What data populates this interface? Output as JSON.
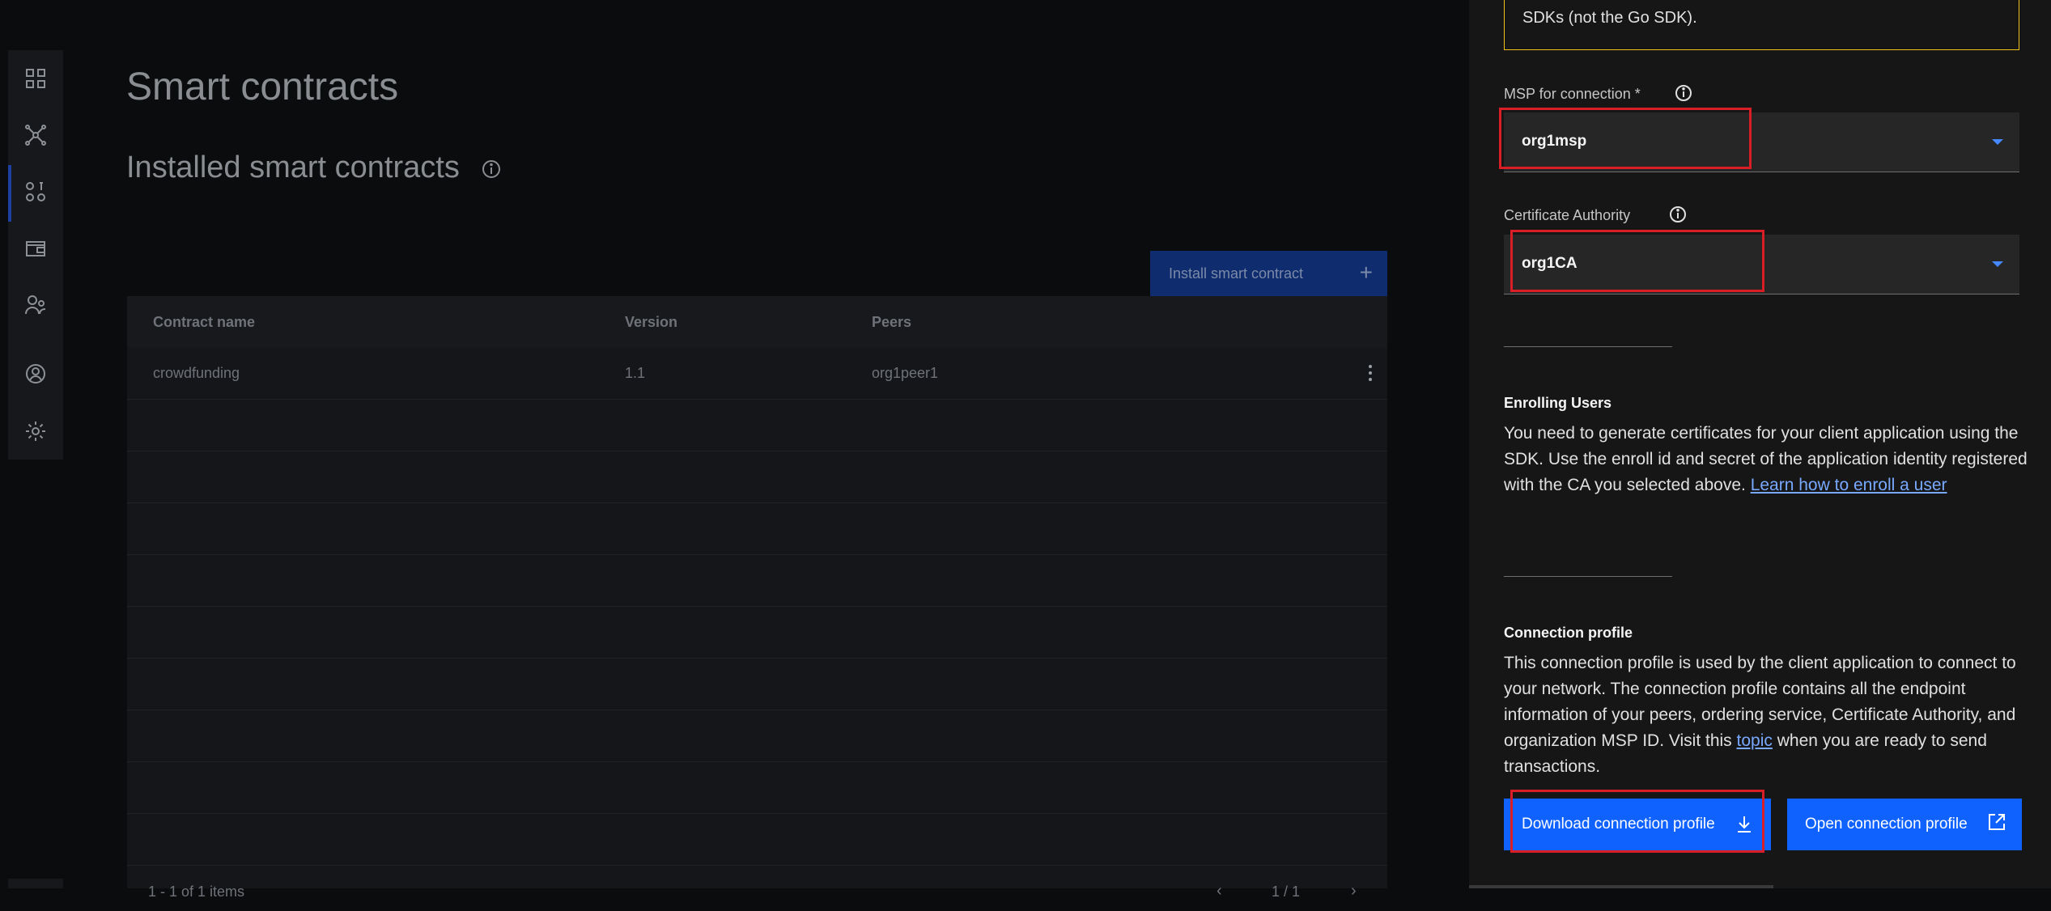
{
  "main": {
    "page_title": "Smart contracts",
    "section_title": "Installed smart contracts",
    "install_button": "Install smart contract",
    "table": {
      "headers": [
        "Contract name",
        "Version",
        "Peers"
      ],
      "rows": [
        {
          "name": "crowdfunding",
          "version": "1.1",
          "peers": "org1peer1"
        }
      ],
      "footer_items": "1 - 1 of 1 items",
      "footer_pages": "1 / 1"
    }
  },
  "panel": {
    "warning_text": "SDKs (not the Go SDK).",
    "msp_label": "MSP for connection *",
    "msp_value": "org1msp",
    "ca_label": "Certificate Authority",
    "ca_value": "org1CA",
    "enrolling_heading": "Enrolling Users",
    "enrolling_text": "You need to generate certificates for your client application using the SDK. Use the enroll id and secret of the application identity registered with the CA you selected above.",
    "enrolling_link": "Learn how to enroll a user",
    "profile_heading": "Connection profile",
    "profile_text_1": "This connection profile is used by the client application to connect to your network. The connection profile contains all the endpoint information of your peers, ordering service, Certificate Authority, and organization MSP ID. Visit this",
    "profile_link": "topic",
    "profile_text_2": "when you are ready to send transactions.",
    "download_button": "Download connection profile",
    "open_button": "Open connection profile"
  },
  "colors": {
    "accent": "#0f62fe",
    "link": "#78a9ff",
    "warning_border": "#f1c21b",
    "highlight": "#da1e28"
  }
}
